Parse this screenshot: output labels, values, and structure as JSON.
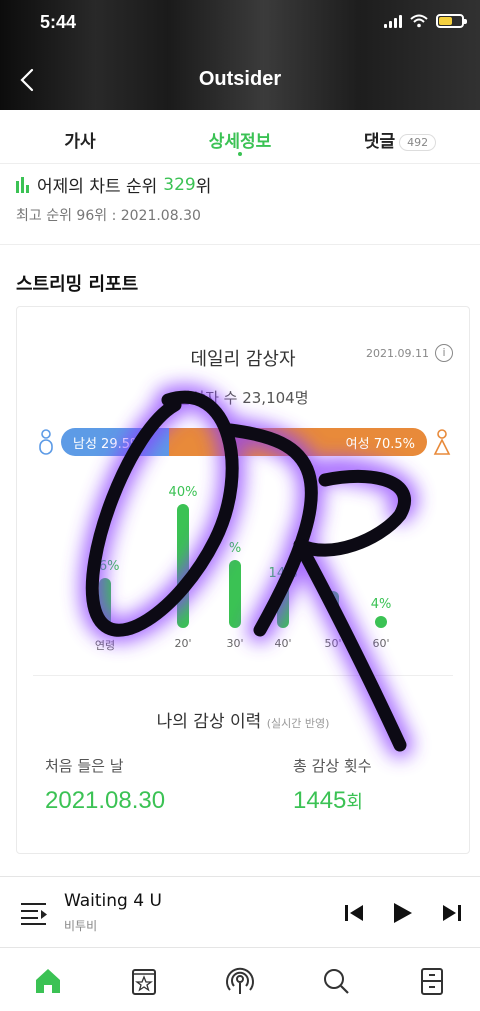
{
  "status_bar": {
    "time": "5:44"
  },
  "header": {
    "title": "Outsider"
  },
  "tabs": [
    {
      "label": "가사"
    },
    {
      "label": "상세정보",
      "active": true
    },
    {
      "label": "댓글",
      "badge": "492"
    }
  ],
  "chart_rank": {
    "label": "어제의 차트 순위",
    "rank": "329",
    "suffix": "위",
    "best": "최고 순위 96위 : 2021.08.30"
  },
  "streaming_report": {
    "title": "스트리밍 리포트",
    "daily": {
      "title": "데일리 감상자",
      "date": "2021.09.11",
      "total": "감상자 수 23,104명",
      "male_label": "남성 29.5%",
      "female_label": "여성 70.5%",
      "male_share": 0.295,
      "ages": [
        {
          "label": "연령",
          "pct": "16%",
          "value": 16
        },
        {
          "label": "20'",
          "pct": "40%",
          "value": 40
        },
        {
          "label": "30'",
          "pct": "%",
          "value": 22
        },
        {
          "label": "40'",
          "pct": "14%",
          "value": 14
        },
        {
          "label": "50'",
          "pct": "",
          "value": 7
        },
        {
          "label": "60'",
          "pct": "4%",
          "value": 4
        }
      ]
    },
    "history": {
      "title": "나의 감상 이력",
      "subtitle": "(실시간 반영)",
      "first_label": "처음 들은 날",
      "first_value": "2021.08.30",
      "count_label": "총 감상 횟수",
      "count_value": "1445",
      "count_unit": "회"
    }
  },
  "player": {
    "song": "Waiting 4 U",
    "artist": "비투비"
  },
  "colors": {
    "accent": "#3bc254",
    "male": "#5d9be6",
    "female": "#e88a3a"
  }
}
